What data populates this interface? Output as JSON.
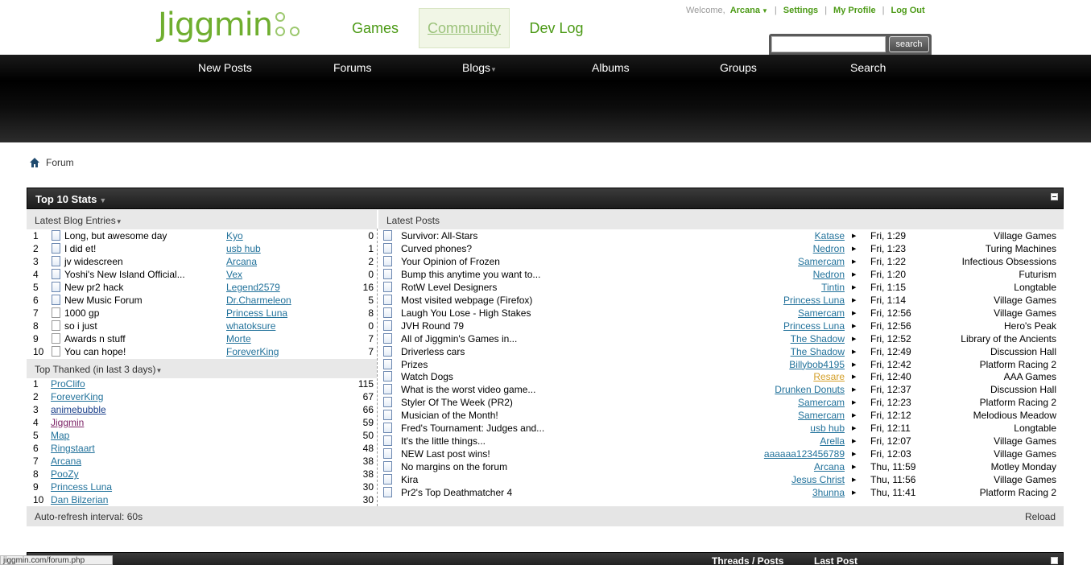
{
  "header": {
    "logo_text": "Jiggmin",
    "nav": {
      "games": "Games",
      "community": "Community",
      "devlog": "Dev Log"
    },
    "welcome": "Welcome,",
    "username": "Arcana",
    "settings": "Settings",
    "my_profile": "My Profile",
    "log_out": "Log Out",
    "search_button": "search",
    "search_value": ""
  },
  "navbar": [
    {
      "label": "New Posts"
    },
    {
      "label": "Forums"
    },
    {
      "label": "Blogs",
      "dropdown": true
    },
    {
      "label": "Albums"
    },
    {
      "label": "Groups"
    },
    {
      "label": "Search"
    }
  ],
  "breadcrumb": {
    "label": "Forum"
  },
  "stats": {
    "title": "Top 10 Stats",
    "blog_header": "Latest Blog Entries",
    "thanked_header": "Top Thanked (in last 3 days)",
    "posts_header": "Latest Posts",
    "footer_refresh": "Auto-refresh interval: 60s",
    "footer_reload": "Reload",
    "blog_entries": [
      {
        "n": "1",
        "title": "Long, but awesome day",
        "user": "Kyo",
        "count": "0",
        "icon": "doc"
      },
      {
        "n": "2",
        "title": "I did et!",
        "user": "usb hub",
        "count": "1",
        "icon": "doc"
      },
      {
        "n": "3",
        "title": "jv widescreen",
        "user": "Arcana",
        "count": "2",
        "icon": "doc"
      },
      {
        "n": "4",
        "title": "Yoshi's New Island Official...",
        "user": "Vex",
        "count": "0",
        "icon": "doc"
      },
      {
        "n": "5",
        "title": "New pr2 hack",
        "user": "Legend2579",
        "count": "16",
        "icon": "doc"
      },
      {
        "n": "6",
        "title": "New Music Forum",
        "user": "Dr.Charmeleon",
        "count": "5",
        "icon": "doc"
      },
      {
        "n": "7",
        "title": "1000 gp",
        "user": "Princess Luna",
        "count": "8",
        "icon": "hollow"
      },
      {
        "n": "8",
        "title": "so i just",
        "user": "whatoksure",
        "count": "0",
        "icon": "hollow"
      },
      {
        "n": "9",
        "title": "Awards n stuff",
        "user": "Morte",
        "count": "7",
        "icon": "hollow"
      },
      {
        "n": "10",
        "title": "You can hope!",
        "user": "ForeverKing",
        "count": "7",
        "icon": "hollow"
      }
    ],
    "top_thanked": [
      {
        "n": "1",
        "user": "ProClifo",
        "count": "115",
        "color": "link"
      },
      {
        "n": "2",
        "user": "ForeverKing",
        "count": "67",
        "color": "link"
      },
      {
        "n": "3",
        "user": "animebubble",
        "count": "66",
        "color": "blue"
      },
      {
        "n": "4",
        "user": "Jiggmin",
        "count": "59",
        "color": "magenta"
      },
      {
        "n": "5",
        "user": "Map",
        "count": "50",
        "color": "link"
      },
      {
        "n": "6",
        "user": "Ringstaart",
        "count": "48",
        "color": "link"
      },
      {
        "n": "7",
        "user": "Arcana",
        "count": "38",
        "color": "link"
      },
      {
        "n": "8",
        "user": "PooZy",
        "count": "38",
        "color": "link"
      },
      {
        "n": "9",
        "user": "Princess Luna",
        "count": "30",
        "color": "link"
      },
      {
        "n": "10",
        "user": "Dan Bilzerian",
        "count": "30",
        "color": "link"
      }
    ],
    "latest_posts": [
      {
        "title": "Survivor: All-Stars",
        "user": "Katase",
        "time": "Fri, 1:29",
        "forum": "Village Games",
        "color": "link"
      },
      {
        "title": "Curved phones?",
        "user": "Nedron",
        "time": "Fri, 1:23",
        "forum": "Turing Machines",
        "color": "link"
      },
      {
        "title": "Your Opinion of Frozen",
        "user": "Samercam",
        "time": "Fri, 1:22",
        "forum": "Infectious Obsessions",
        "color": "link"
      },
      {
        "title": "Bump this anytime you want to...",
        "user": "Nedron",
        "time": "Fri, 1:20",
        "forum": "Futurism",
        "color": "link"
      },
      {
        "title": "RotW Level Designers",
        "user": "Tintin",
        "time": "Fri, 1:15",
        "forum": "Longtable",
        "color": "link"
      },
      {
        "title": "Most visited webpage (Firefox)",
        "user": "Princess Luna",
        "time": "Fri, 1:14",
        "forum": "Village Games",
        "color": "link"
      },
      {
        "title": "Laugh You Lose - High Stakes",
        "user": "Samercam",
        "time": "Fri, 12:56",
        "forum": "Village Games",
        "color": "link"
      },
      {
        "title": "JVH Round 79",
        "user": "Princess Luna",
        "time": "Fri, 12:56",
        "forum": "Hero's Peak",
        "color": "link"
      },
      {
        "title": "All of Jiggmin's Games in...",
        "user": "The Shadow",
        "time": "Fri, 12:52",
        "forum": "Library of the Ancients",
        "color": "link"
      },
      {
        "title": "Driverless cars",
        "user": "The Shadow",
        "time": "Fri, 12:49",
        "forum": "Discussion Hall",
        "color": "link"
      },
      {
        "title": "Prizes",
        "user": "Billybob4195",
        "time": "Fri, 12:42",
        "forum": "Platform Racing 2",
        "color": "link"
      },
      {
        "title": "Watch Dogs",
        "user": "Resare",
        "time": "Fri, 12:40",
        "forum": "AAA Games",
        "color": "gold"
      },
      {
        "title": "What is the worst video game...",
        "user": "Drunken Donuts",
        "time": "Fri, 12:37",
        "forum": "Discussion Hall",
        "color": "link"
      },
      {
        "title": "Styler Of The Week (PR2)",
        "user": "Samercam",
        "time": "Fri, 12:23",
        "forum": "Platform Racing 2",
        "color": "link"
      },
      {
        "title": "Musician of the Month!",
        "user": "Samercam",
        "time": "Fri, 12:12",
        "forum": "Melodious Meadow",
        "color": "link"
      },
      {
        "title": "Fred's Tournament: Judges and...",
        "user": "usb hub",
        "time": "Fri, 12:11",
        "forum": "Longtable",
        "color": "link"
      },
      {
        "title": "It's the little things...",
        "user": "Arella",
        "time": "Fri, 12:07",
        "forum": "Village Games",
        "color": "link"
      },
      {
        "title": "NEW Last post wins!",
        "user": "aaaaaa123456789",
        "time": "Fri, 12:03",
        "forum": "Village Games",
        "color": "link"
      },
      {
        "title": "No margins on the forum",
        "user": "Arcana",
        "time": "Thu, 11:59",
        "forum": "Motley Monday",
        "color": "link"
      },
      {
        "title": "Kira",
        "user": "Jesus Christ",
        "time": "Thu, 11:56",
        "forum": "Village Games",
        "color": "link"
      },
      {
        "title": "Pr2's Top Deathmatcher 4",
        "user": "3hunna",
        "time": "Thu, 11:41",
        "forum": "Platform Racing 2",
        "color": "link"
      }
    ]
  },
  "next_section": {
    "col_threads_posts": "Threads / Posts",
    "col_last_post": "Last Post"
  },
  "status_bar": "jiggmin.com/forum.php",
  "colors": {
    "brand_green": "#6fae2f",
    "link": "#22729b",
    "magenta": "#7b2266",
    "gold": "#d4a02a"
  }
}
